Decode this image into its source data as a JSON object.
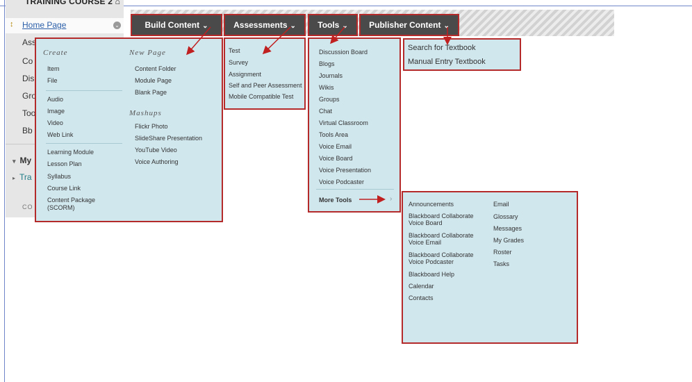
{
  "course_menu": {
    "title": "TRAINING COURSE 2",
    "home": "Home Page",
    "items": [
      "Ass",
      "Co",
      "Dis",
      "Gro",
      "Too",
      "Bb"
    ],
    "my_section": "My",
    "tra": "Tra",
    "co_label": "CO"
  },
  "menu_bar": {
    "build": "Build Content",
    "assess": "Assessments",
    "tools": "Tools",
    "publisher": "Publisher Content"
  },
  "build_menu": {
    "create_heading": "Create",
    "create_items": [
      "Item",
      "File",
      "Audio",
      "Image",
      "Video",
      "Web Link",
      "Learning Module",
      "Lesson Plan",
      "Syllabus",
      "Course Link",
      "Content Package (SCORM)"
    ],
    "newpage_heading": "New Page",
    "newpage_items": [
      "Content Folder",
      "Module Page",
      "Blank Page"
    ],
    "mashups_heading": "Mashups",
    "mashups_items": [
      "Flickr Photo",
      "SlideShare Presentation",
      "YouTube Video",
      "Voice Authoring"
    ]
  },
  "assessment_menu": {
    "items": [
      "Test",
      "Survey",
      "Assignment",
      "Self and Peer Assessment",
      "Mobile Compatible Test"
    ]
  },
  "tools_menu": {
    "items": [
      "Discussion Board",
      "Blogs",
      "Journals",
      "Wikis",
      "Groups",
      "Chat",
      "Virtual Classroom",
      "Tools Area",
      "Voice Email",
      "Voice Board",
      "Voice Presentation",
      "Voice Podcaster"
    ],
    "more": "More Tools"
  },
  "publisher_menu": {
    "items": [
      "Search for Textbook",
      "Manual Entry Textbook"
    ]
  },
  "more_tools_menu": {
    "col1": [
      "Announcements",
      "Blackboard Collaborate Voice Board",
      "Blackboard Collaborate Voice Email",
      "Blackboard Collaborate Voice Podcaster",
      "Blackboard Help",
      "Calendar",
      "Contacts"
    ],
    "col2": [
      "Email",
      "Glossary",
      "Messages",
      "My Grades",
      "Roster",
      "Tasks"
    ]
  },
  "colors": {
    "panel_bg": "#d1e7ee",
    "highlight_border": "#b42a2a",
    "tab_bg": "#4a4a4a",
    "link": "#2a5ea8"
  }
}
